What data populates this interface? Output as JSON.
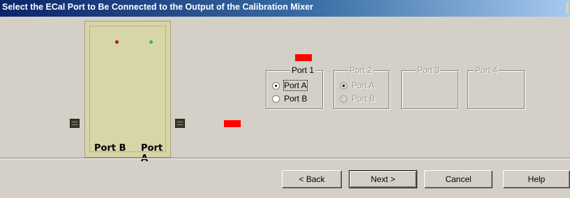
{
  "dialog": {
    "title": "Select the ECal Port to Be Connected to the Output of the Calibration Mixer"
  },
  "ecal_module": {
    "port_b_label": "Port B",
    "port_a_label": "Port A",
    "led_colors": [
      "#b01818",
      "#3cb838"
    ],
    "marker_color": "#ff0000"
  },
  "port_groups": [
    {
      "title": "Port 1",
      "enabled": true,
      "options": [
        "Port A",
        "Port B"
      ],
      "selected": "Port A"
    },
    {
      "title": "Port 2",
      "enabled": false,
      "options": [
        "Port A",
        "Port B"
      ],
      "selected": "Port A"
    },
    {
      "title": "Port 3",
      "enabled": false
    },
    {
      "title": "Port 4",
      "enabled": false
    }
  ],
  "buttons": {
    "back": "< Back",
    "next": "Next >",
    "cancel": "Cancel",
    "help": "Help"
  }
}
